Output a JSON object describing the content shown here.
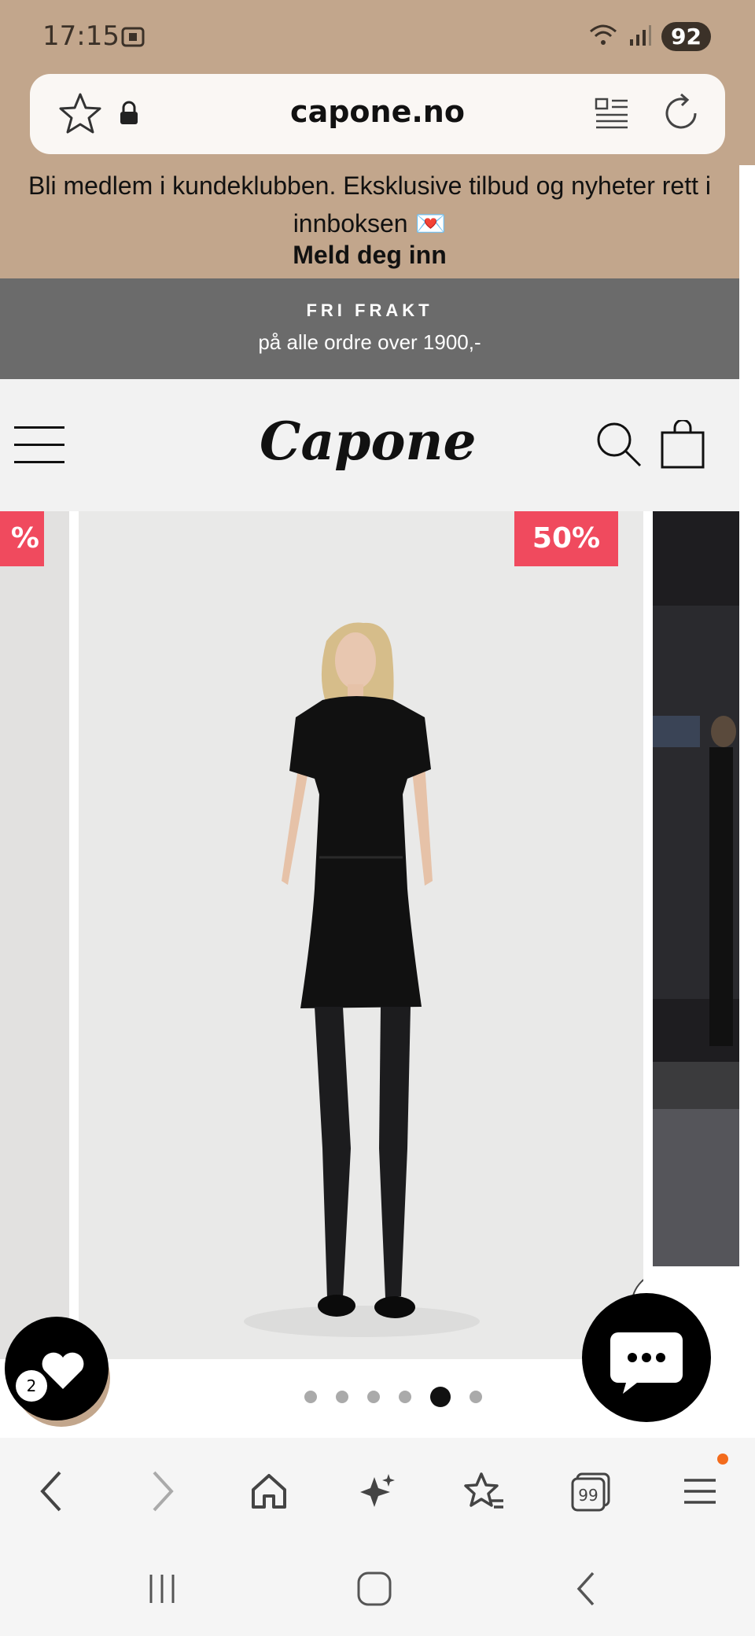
{
  "status_bar": {
    "time": "17:15",
    "battery": "92",
    "icons": [
      "screenshot-icon",
      "wifi-icon",
      "signal-icon"
    ]
  },
  "browser": {
    "url": "capone.no",
    "icons": [
      "star-icon",
      "lock-icon",
      "reader-mode-icon",
      "reload-icon"
    ]
  },
  "promo": {
    "text": "Bli medlem i kundeklubben. Eksklusive tilbud og nyheter rett i innboksen 💌",
    "cta": "Meld deg inn"
  },
  "shipping": {
    "title": "FRI FRAKT",
    "subtitle": "på alle ordre over 1900,-"
  },
  "header": {
    "logo": "Capone",
    "icons": [
      "menu-icon",
      "search-icon",
      "bag-icon"
    ]
  },
  "gallery": {
    "prev_badge": "%",
    "main_badge": "50%",
    "dot_count": 6,
    "active_dot": 5
  },
  "wishlist": {
    "count": "2"
  },
  "toolbar": {
    "items": [
      "back-icon",
      "forward-icon",
      "home-icon",
      "ai-sparkle-icon",
      "bookmarks-icon",
      "tabs-icon",
      "menu-icon"
    ],
    "tabs_count": "99"
  },
  "system_nav": [
    "recents-icon",
    "home-icon",
    "back-icon"
  ]
}
